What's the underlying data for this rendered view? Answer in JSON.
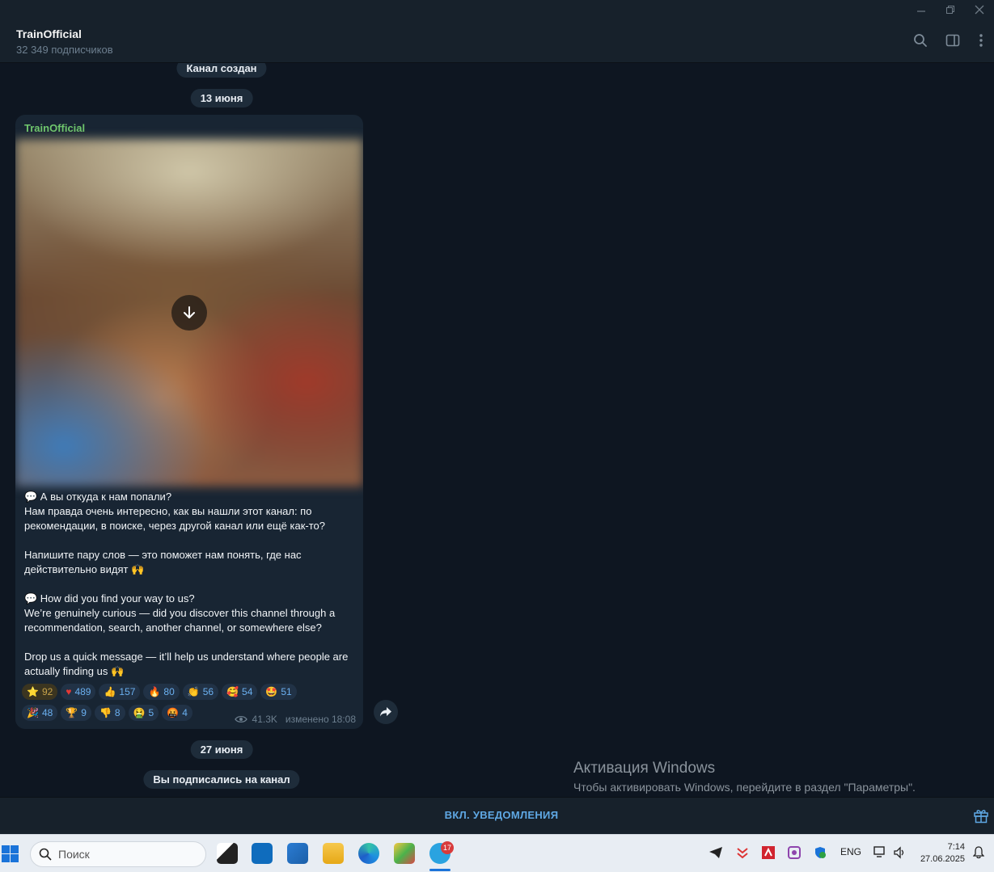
{
  "window": {
    "minimize_icon": "minimize-icon",
    "restore_icon": "restore-icon",
    "close_icon": "close-icon"
  },
  "header": {
    "title": "TrainOfficial",
    "subscribers": "32 349 подписчиков"
  },
  "service": {
    "channel_created": "Канал создан",
    "date1": "13 июня",
    "date2": "27 июня",
    "subscribed": "Вы подписались на канал"
  },
  "post": {
    "author": "TrainOfficial",
    "text": "💬 А вы откуда к нам попали?\nНам правда очень интересно, как вы нашли этот канал: по рекомендации, в поиске, через другой канал или ещё как-то?\n\nНапишите пару слов — это поможет нам понять, где нас действительно видят 🙌\n\n💬 How did you find your way to us?\nWe’re genuinely curious — did you discover this channel through a recommendation, search, another channel, or somewhere else?\n\nDrop us a quick message — it’ll help us understand where people are actually finding us 🙌",
    "reactions_row1": [
      {
        "emoji": "⭐",
        "count": "92",
        "style": "gold"
      },
      {
        "emoji": "♥",
        "count": "489"
      },
      {
        "emoji": "👍",
        "count": "157"
      },
      {
        "emoji": "🔥",
        "count": "80"
      },
      {
        "emoji": "👏",
        "count": "56"
      },
      {
        "emoji": "🥰",
        "count": "54"
      },
      {
        "emoji": "🤩",
        "count": "51"
      }
    ],
    "reactions_row2": [
      {
        "emoji": "🎉",
        "count": "48"
      },
      {
        "emoji": "🏆",
        "count": "9"
      },
      {
        "emoji": "👎",
        "count": "8"
      },
      {
        "emoji": "🤮",
        "count": "5"
      },
      {
        "emoji": "🤬",
        "count": "4"
      }
    ],
    "views": "41.3K",
    "edited": "изменено 18:08"
  },
  "watermark": {
    "title": "Активация Windows",
    "subtitle": "Чтобы активировать Windows, перейдите в раздел \"Параметры\"."
  },
  "notify": {
    "label": "ВКЛ. УВЕДОМЛЕНИЯ"
  },
  "taskbar": {
    "search_placeholder": "Поиск",
    "telegram_badge": "17",
    "lang": "ENG",
    "time": "7:14",
    "date": "27.06.2025"
  }
}
